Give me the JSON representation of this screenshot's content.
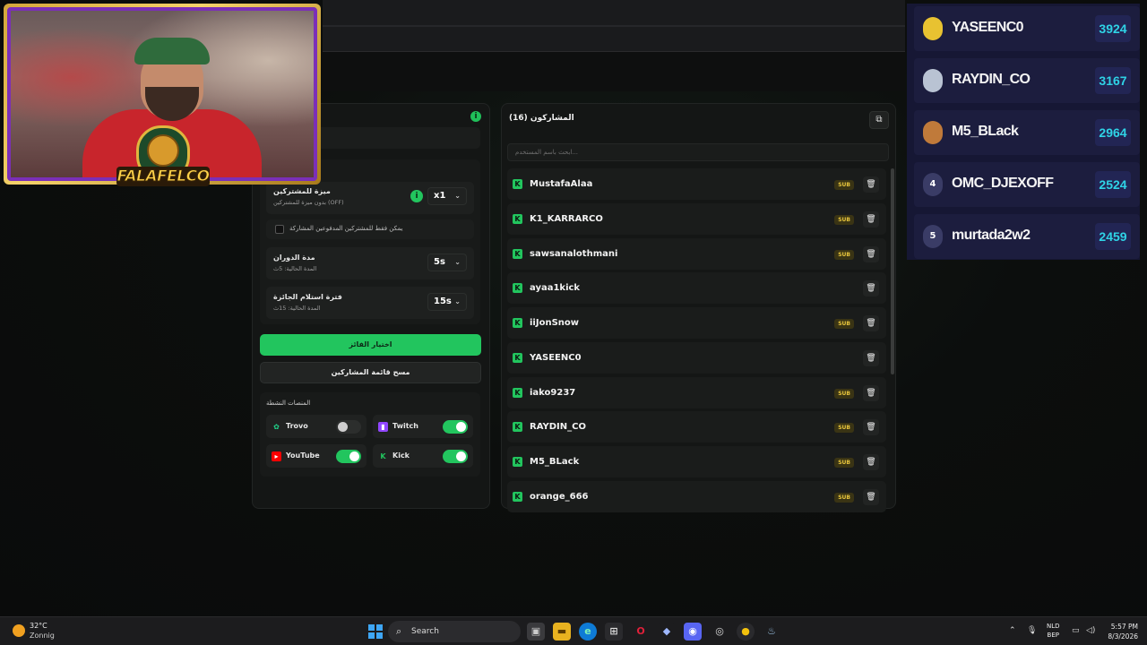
{
  "overlay": {
    "logo_text": "FALAFELCO"
  },
  "left_panel": {
    "rows": [
      {
        "title": "ميزة للمشتركين",
        "subtitle": "بدون ميزة للمشتركين (OFF)",
        "value": "x1"
      },
      {
        "title": "مدة الدوران",
        "subtitle": "المدة الحالية: 5ث",
        "value": "5s"
      },
      {
        "title": "فترة استلام الجائزة",
        "subtitle": "المدة الحالية: 15ث",
        "value": "15s"
      }
    ],
    "paid_only_label": "يمكن فقط للمشتركين المدفوعين المشاركة",
    "pick_winner_label": "اختيار الفائز",
    "clear_list_label": "مسح قائمة المشاركين",
    "platforms_title": "المنصات النشطة",
    "platforms": [
      {
        "name": "Trovo",
        "enabled": false,
        "color": "#1fd38a"
      },
      {
        "name": "Twitch",
        "enabled": true,
        "color": "#9146ff"
      },
      {
        "name": "YouTube",
        "enabled": true,
        "color": "#ff0000"
      },
      {
        "name": "Kick",
        "enabled": true,
        "color": "#53fc18"
      }
    ],
    "info_icon": "info-icon"
  },
  "participants": {
    "title": "المشاركون (16)",
    "search_placeholder": "ابحث باسم المستخدم...",
    "sub_badge": "SUB",
    "list": [
      {
        "name": "MustafaAlaa",
        "sub": true
      },
      {
        "name": "K1_KARRARCO",
        "sub": true
      },
      {
        "name": "sawsanalothmani",
        "sub": true
      },
      {
        "name": "ayaa1kick",
        "sub": false
      },
      {
        "name": "iiJonSnow",
        "sub": true
      },
      {
        "name": "YASEENC0",
        "sub": false
      },
      {
        "name": "iako9237",
        "sub": true
      },
      {
        "name": "RAYDIN_CO",
        "sub": true
      },
      {
        "name": "M5_BLack",
        "sub": true
      },
      {
        "name": "orange_666",
        "sub": true
      }
    ]
  },
  "leaderboard": [
    {
      "rank": "",
      "name": "YASEENC0",
      "score": "3924",
      "medal_color": "#e8c231"
    },
    {
      "rank": "",
      "name": "RAYDIN_CO",
      "score": "3167",
      "medal_color": "#b9c3d3"
    },
    {
      "rank": "",
      "name": "M5_BLack",
      "score": "2964",
      "medal_color": "#c07a3a"
    },
    {
      "rank": "4",
      "name": "OMC_DJEXOFF",
      "score": "2524",
      "medal_color": "#3a3c66"
    },
    {
      "rank": "5",
      "name": "murtada2w2",
      "score": "2459",
      "medal_color": "#3a3c66"
    }
  ],
  "taskbar": {
    "weather_temp": "32°C",
    "weather_desc": "Zonnig",
    "search_label": "Search",
    "lang_line1": "NLD",
    "lang_line2": "BEP",
    "time": "5:57 PM",
    "date": "8/3/2026"
  }
}
